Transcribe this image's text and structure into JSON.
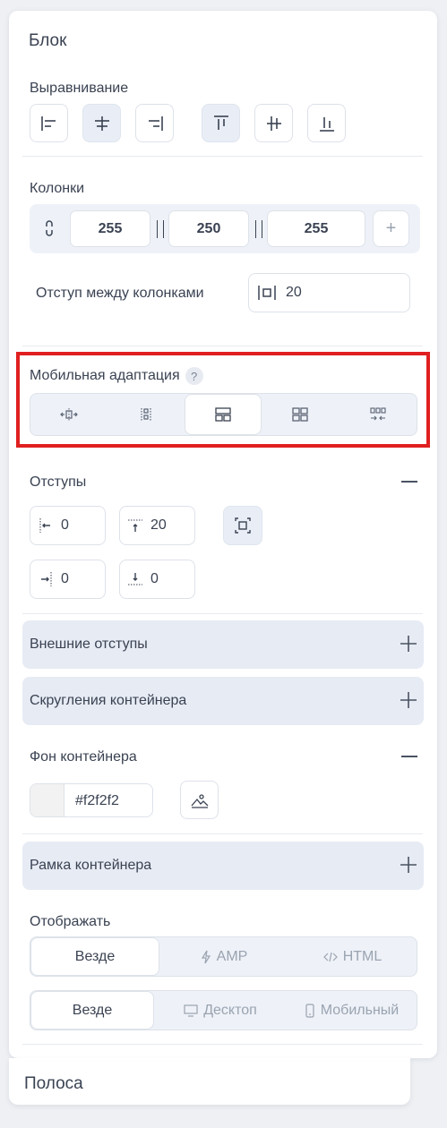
{
  "panel": {
    "title": "Блок",
    "alignment": {
      "label": "Выравнивание",
      "buttons": [
        "align-left",
        "align-center",
        "align-right",
        "align-top",
        "align-middle",
        "align-bottom"
      ]
    },
    "columns": {
      "label": "Колонки",
      "values": [
        "255",
        "250",
        "255"
      ],
      "add": "+"
    },
    "column_gap": {
      "label": "Отступ между колонками",
      "value": "20"
    },
    "mobile": {
      "label": "Мобильная адаптация",
      "help": "?"
    },
    "padding": {
      "label": "Отступы",
      "left": "0",
      "top": "20",
      "right": "0",
      "bottom": "0"
    },
    "outer_margins": {
      "label": "Внешние отступы"
    },
    "container_radius": {
      "label": "Скругления контейнера"
    },
    "container_bg": {
      "label": "Фон контейнера",
      "color": "#f2f2f2"
    },
    "container_border": {
      "label": "Рамка контейнера"
    },
    "display": {
      "label": "Отображать",
      "row1": [
        "Везде",
        "AMP",
        "HTML"
      ],
      "row2": [
        "Везде",
        "Десктоп",
        "Мобильный"
      ]
    }
  },
  "below_panel": {
    "title": "Полоса"
  },
  "colors": {
    "accent_bg": "#eef2f8",
    "highlight": "#e02020",
    "text": "#3a4252"
  }
}
